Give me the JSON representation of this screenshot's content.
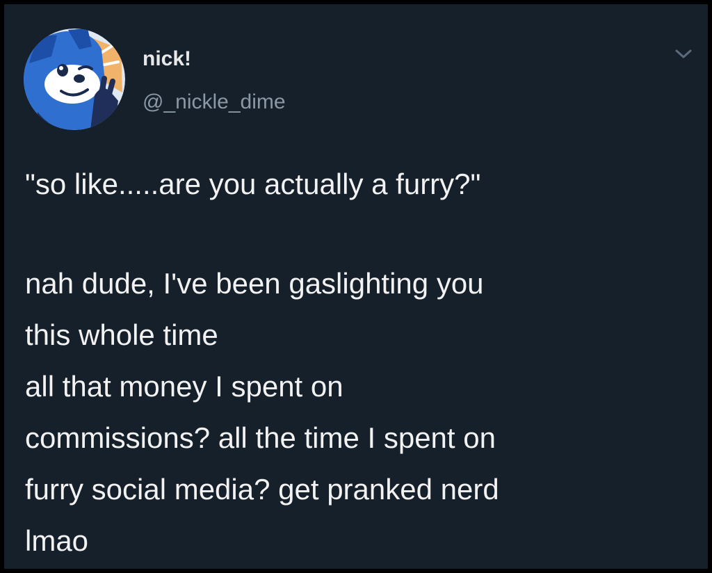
{
  "tweet": {
    "author": {
      "display_name": "nick!",
      "handle": "@_nickle_dime",
      "avatar_icon": "blue-fox-avatar"
    },
    "menu_icon": "chevron-down-icon",
    "body": {
      "quote": "\"so like.....are you actually a furry?\"",
      "lines": [
        "nah dude, I've been gaslighting you",
        "this whole time",
        "all that money I spent on",
        "commissions? all the time I spent on",
        "furry social media? get pranked nerd",
        "lmao"
      ]
    }
  },
  "colors": {
    "background": "#15202b",
    "frame": "#000000",
    "text": "#f2f2f2",
    "secondary_text": "#8b98a5"
  }
}
